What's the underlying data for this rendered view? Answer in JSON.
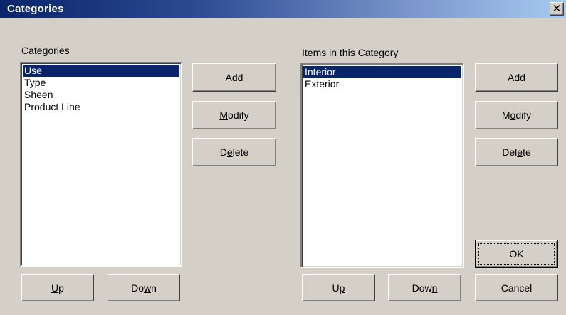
{
  "window": {
    "title": "Categories",
    "close_glyph": "✕"
  },
  "categories": {
    "label": "Categories",
    "items": [
      "Use",
      "Type",
      "Sheen",
      "Product Line"
    ],
    "selected_index": 0,
    "buttons": {
      "add": {
        "pre": "",
        "ul": "A",
        "post": "dd"
      },
      "modify": {
        "pre": "",
        "ul": "M",
        "post": "odify"
      },
      "delete": {
        "pre": "D",
        "ul": "e",
        "post": "lete"
      },
      "up": {
        "pre": "",
        "ul": "U",
        "post": "p"
      },
      "down": {
        "pre": "Do",
        "ul": "w",
        "post": "n"
      }
    }
  },
  "items_panel": {
    "label": "Items in this Category",
    "items": [
      "Interior",
      "Exterior"
    ],
    "selected_index": 0,
    "buttons": {
      "add": {
        "pre": "A",
        "ul": "d",
        "post": "d"
      },
      "modify": {
        "pre": "M",
        "ul": "o",
        "post": "dify"
      },
      "delete": {
        "pre": "Del",
        "ul": "e",
        "post": "te"
      },
      "up": {
        "pre": "U",
        "ul": "p",
        "post": ""
      },
      "down": {
        "pre": "Dow",
        "ul": "n",
        "post": ""
      }
    }
  },
  "dialog_buttons": {
    "ok": "OK",
    "cancel": "Cancel"
  },
  "icons": {
    "close": "close-icon"
  },
  "colors": {
    "selection": "#0a246a",
    "title_start": "#0a246a",
    "title_end": "#a6caf0",
    "face": "#d4d0c8"
  }
}
